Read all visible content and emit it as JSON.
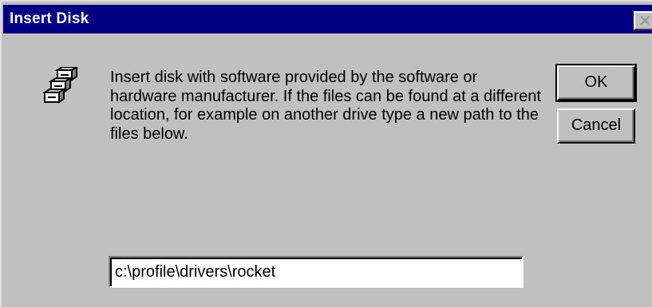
{
  "window": {
    "title": "Insert Disk",
    "close_glyph": "✕"
  },
  "icon": "disk-drives-icon",
  "message": "Insert disk with software provided by the software or hardware manufacturer.  If the files can be found at a different location, for example on another drive type a new path to the files below.",
  "buttons": {
    "ok_label": "OK",
    "cancel_label": "Cancel"
  },
  "path_input": {
    "value": "c:\\profile\\drivers\\rocket"
  },
  "colors": {
    "titlebar": "#000080",
    "dialog_bg": "#c0c0c0"
  }
}
